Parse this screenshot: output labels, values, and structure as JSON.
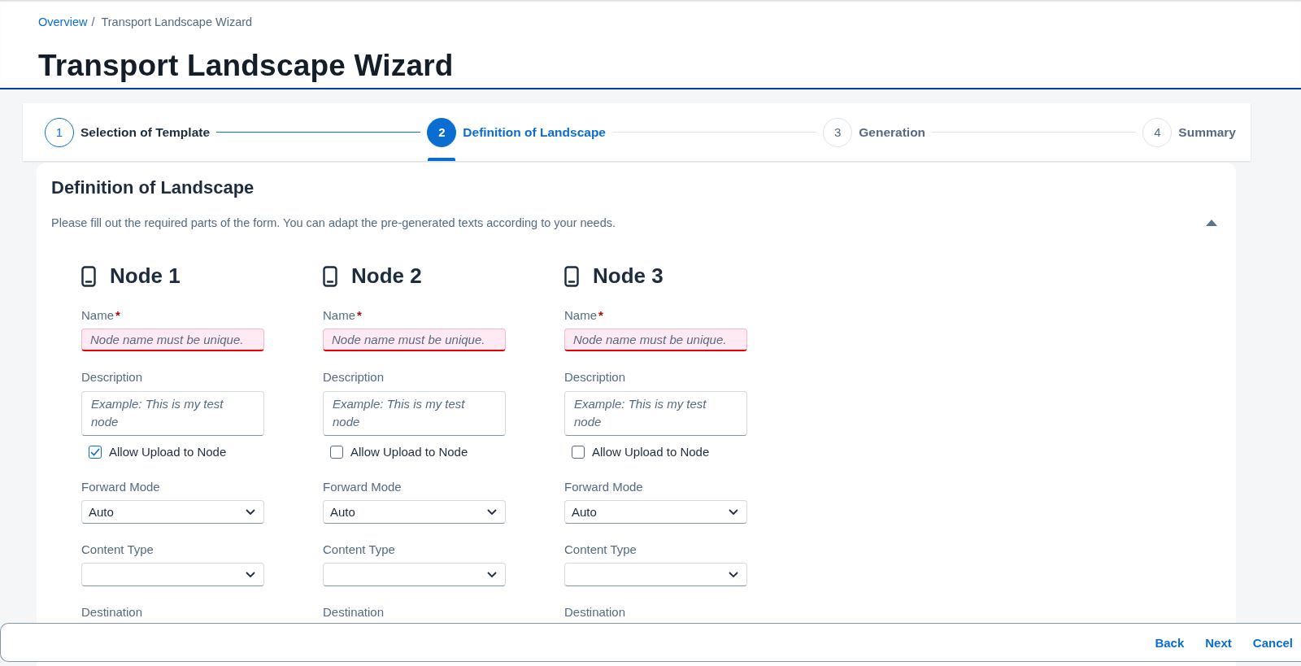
{
  "breadcrumb": {
    "separator": "/",
    "items": [
      {
        "label": "Overview",
        "kind": "link"
      },
      {
        "label": "Transport Landscape Wizard",
        "kind": "current"
      }
    ]
  },
  "page_title": "Transport Landscape Wizard",
  "steps": [
    {
      "number": "1",
      "label": "Selection of Template",
      "kind": "completed",
      "selected": false
    },
    {
      "number": "2",
      "label": "Definition of Landscape",
      "kind": "active",
      "selected": true
    },
    {
      "number": "3",
      "label": "Generation",
      "kind": "upcoming",
      "selected": false
    },
    {
      "number": "4",
      "label": "Summary",
      "kind": "upcoming",
      "selected": false
    }
  ],
  "section": {
    "title": "Definition of Landscape",
    "description": "Please fill out the required parts of the form. You can adapt the pre-generated texts according to your needs.",
    "expanded": true
  },
  "nodes": [
    {
      "title": "Node 1",
      "name_label": "Name",
      "required_mark": "*",
      "name_placeholder": "Node name must be unique.",
      "name_error": true,
      "description_label": "Description",
      "description_placeholder": "Example: This is my test node",
      "allow_upload_label": "Allow Upload to Node",
      "allow_upload_checked": true,
      "forward_mode_label": "Forward Mode",
      "forward_mode_value": "Auto",
      "content_type_label": "Content Type",
      "destination_label": "Destination"
    },
    {
      "title": "Node 2",
      "name_label": "Name",
      "required_mark": "*",
      "name_placeholder": "Node name must be unique.",
      "name_error": true,
      "description_label": "Description",
      "description_placeholder": "Example: This is my test node",
      "allow_upload_label": "Allow Upload to Node",
      "allow_upload_checked": false,
      "forward_mode_label": "Forward Mode",
      "forward_mode_value": "Auto",
      "content_type_label": "Content Type",
      "destination_label": "Destination"
    },
    {
      "title": "Node 3",
      "name_label": "Name",
      "required_mark": "*",
      "name_placeholder": "Node name must be unique.",
      "name_error": true,
      "description_label": "Description",
      "description_placeholder": "Example: This is my test node",
      "allow_upload_label": "Allow Upload to Node",
      "allow_upload_checked": false,
      "forward_mode_label": "Forward Mode",
      "forward_mode_value": "Auto",
      "content_type_label": "Content Type",
      "destination_label": "Destination"
    }
  ],
  "footer_buttons": [
    "Back",
    "Next",
    "Cancel"
  ]
}
